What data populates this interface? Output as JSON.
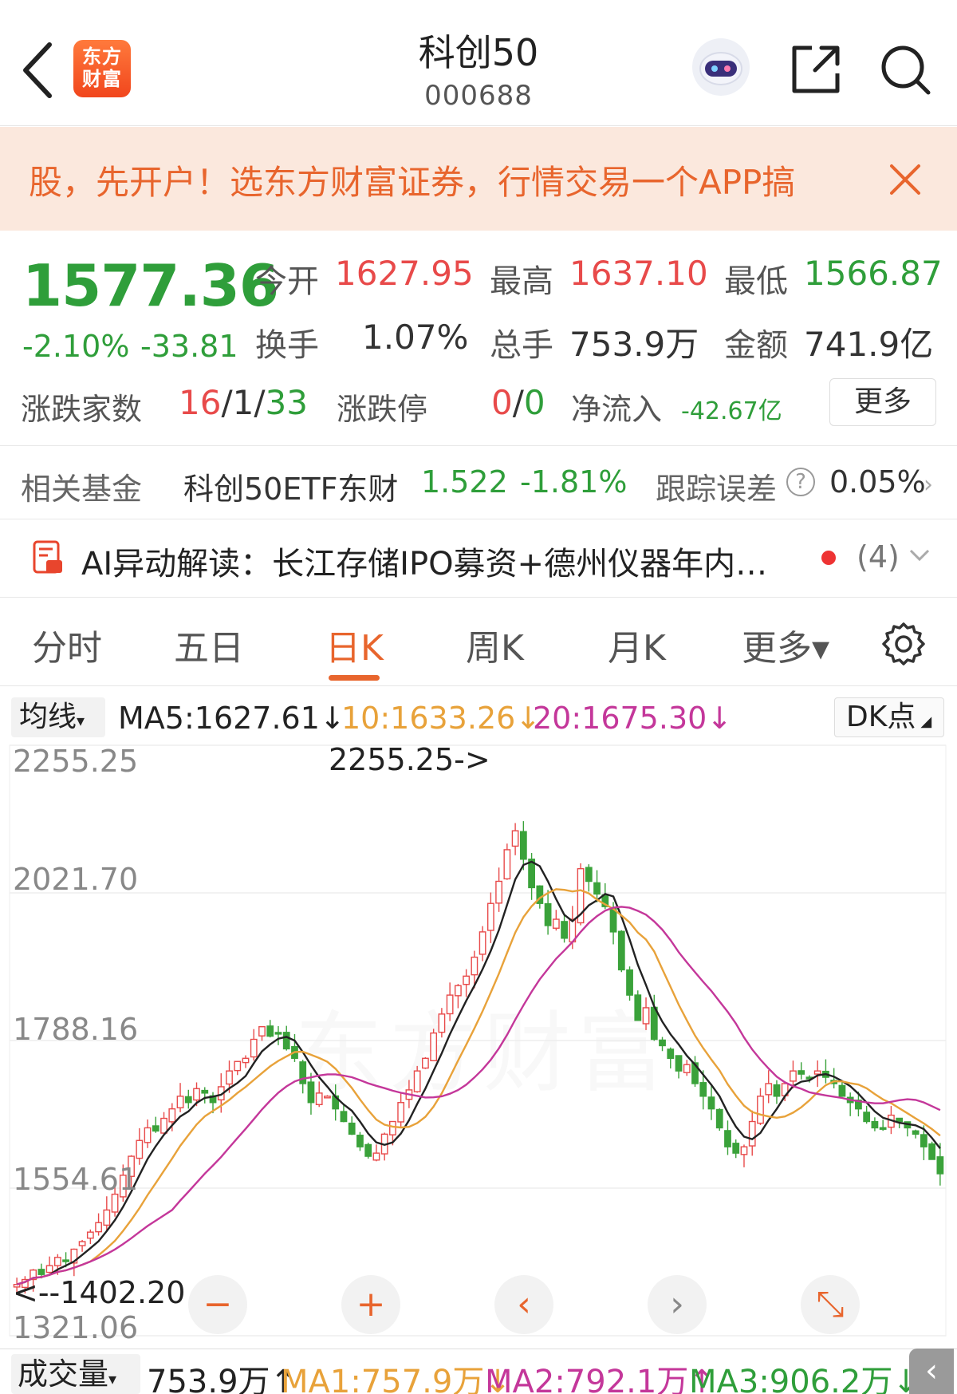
{
  "header": {
    "logo_line1": "东方",
    "logo_line2": "财富",
    "title": "科创50",
    "code": "000688"
  },
  "banner": {
    "text": "股，先开户！选东方财富证券，行情交易一个APP搞"
  },
  "quote": {
    "price": "1577.36",
    "pct": "-2.10%",
    "change": "-33.81",
    "open_label": "今开",
    "open": "1627.95",
    "high_label": "最高",
    "high": "1637.10",
    "low_label": "最低",
    "low": "1566.87",
    "turnover_label": "换手",
    "turnover": "1.07%",
    "volume_label": "总手",
    "volume": "753.9万",
    "amount_label": "金额",
    "amount": "741.9亿",
    "breadth_label": "涨跌家数",
    "breadth_up": "16",
    "breadth_sep1": "/",
    "breadth_flat": "1",
    "breadth_sep2": "/",
    "breadth_down": "33",
    "limit_label": "涨跌停",
    "limit_up": "0",
    "limit_sep": "/",
    "limit_down": "0",
    "inflow_label": "净流入",
    "inflow": "-42.67亿",
    "more_label": "更多"
  },
  "fund": {
    "label": "相关基金",
    "name": "科创50ETF东财",
    "price": "1.522",
    "pct": "-1.81%",
    "track_label": "跟踪误差",
    "help": "?",
    "track_value": "0.05%",
    "chevron": "›"
  },
  "ai": {
    "text": "AI异动解读：长江存储IPO募资+德州仪器年内…",
    "count": "(4)"
  },
  "tabs": [
    {
      "label": "分时"
    },
    {
      "label": "五日"
    },
    {
      "label": "日K"
    },
    {
      "label": "周K"
    },
    {
      "label": "月K"
    },
    {
      "label": "更多▾"
    }
  ],
  "ma_bar": {
    "select": "均线",
    "ma5": "MA5:1627.61↓",
    "ma10": "10:1633.26↓",
    "ma20": "20:1675.30↓",
    "dk": "DK点"
  },
  "chart_data": {
    "type": "candlestick",
    "y_ticks": [
      "2255.25",
      "2021.70",
      "1788.16",
      "1554.61",
      "1321.06"
    ],
    "ylim": [
      1321.06,
      2255.25
    ],
    "max_annotation": "2255.25->",
    "min_annotation": "<--1402.20",
    "ma_colors": {
      "ma5": "#222222",
      "ma10": "#e8a23a",
      "ma20": "#c4379a"
    },
    "up_color": "#e84a4a",
    "down_color": "#3aa23a",
    "close": [
      1402.2,
      1410,
      1425,
      1418,
      1432,
      1445,
      1440,
      1458,
      1470,
      1485,
      1500,
      1520,
      1545,
      1575,
      1605,
      1630,
      1650,
      1645,
      1665,
      1680,
      1700,
      1690,
      1712,
      1705,
      1690,
      1715,
      1740,
      1755,
      1760,
      1790,
      1810,
      1795,
      1800,
      1775,
      1760,
      1720,
      1690,
      1705,
      1700,
      1680,
      1660,
      1640,
      1620,
      1605,
      1610,
      1640,
      1660,
      1690,
      1710,
      1740,
      1760,
      1800,
      1830,
      1860,
      1875,
      1890,
      1920,
      1960,
      2005,
      2040,
      2090,
      2120,
      2075,
      2030,
      2005,
      1970,
      1980,
      1950,
      1980,
      2060,
      2040,
      2020,
      2000,
      1960,
      1900,
      1860,
      1820,
      1840,
      1790,
      1780,
      1760,
      1740,
      1750,
      1720,
      1700,
      1680,
      1650,
      1620,
      1610,
      1620,
      1660,
      1700,
      1720,
      1700,
      1720,
      1740,
      1735,
      1730,
      1740,
      1730,
      1720,
      1700,
      1690,
      1680,
      1660,
      1650,
      1650,
      1670,
      1660,
      1650,
      1640,
      1620,
      1600,
      1577.36
    ]
  },
  "controls": {
    "minus": "−",
    "plus": "+",
    "left": "‹",
    "right": "›",
    "expand": "⤡"
  },
  "volume_bar": {
    "select": "成交量",
    "vol": "753.9万↑",
    "ma1": "MA1:757.9万↓",
    "ma2": "MA2:792.1万↑",
    "ma3": "MA3:906.2万↓",
    "side": "‹"
  }
}
